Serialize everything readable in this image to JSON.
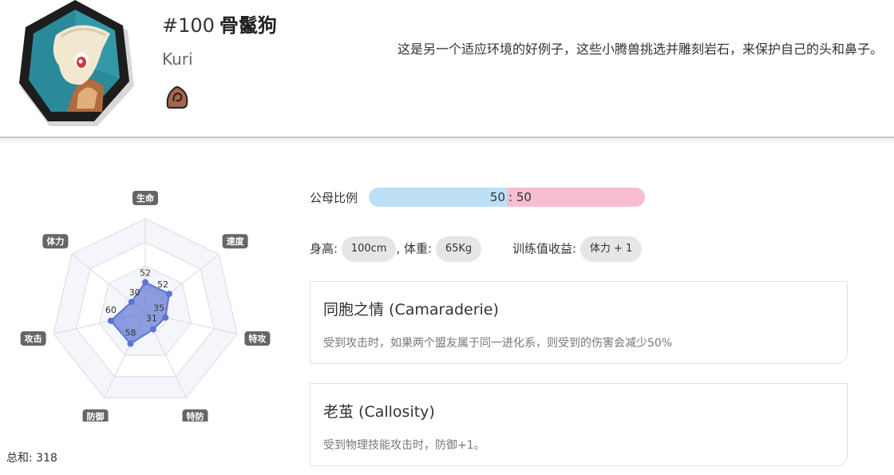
{
  "pokemon": {
    "number": "#100",
    "name": "骨鬣狗",
    "english_name": "Kuri",
    "type_icon": "ground-type-icon",
    "description": "这是另一个适应环境的好例子，这些小腾兽挑选并雕刻岩石，来保护自己的头和鼻子。"
  },
  "stats": {
    "items": [
      {
        "label": "生命",
        "value": 52
      },
      {
        "label": "速度",
        "value": 52
      },
      {
        "label": "特攻",
        "value": 35
      },
      {
        "label": "特防",
        "value": 31
      },
      {
        "label": "防御",
        "value": 58
      },
      {
        "label": "攻击",
        "value": 60
      },
      {
        "label": "体力",
        "value": 30
      }
    ],
    "total_label": "总和: 318",
    "fill_color": "#5b75d1"
  },
  "gender": {
    "label": "公母比例",
    "male": "50",
    "separator": ":",
    "female": "50",
    "male_color": "#bde0f7",
    "female_color": "#f8bdd2"
  },
  "body": {
    "height_label": "身高:",
    "height_value": "100cm",
    "weight_label": ", 体重:",
    "weight_value": "65Kg",
    "training_label": "训练值收益:",
    "training_value": "体力 + 1"
  },
  "abilities": [
    {
      "title": "同胞之情 (Camaraderie)",
      "desc": "受到攻击时，如果两个盟友属于同一进化系，则受到的伤害会减少50%"
    },
    {
      "title": "老茧 (Callosity)",
      "desc": "受到物理技能攻击时，防御+1。"
    }
  ]
}
